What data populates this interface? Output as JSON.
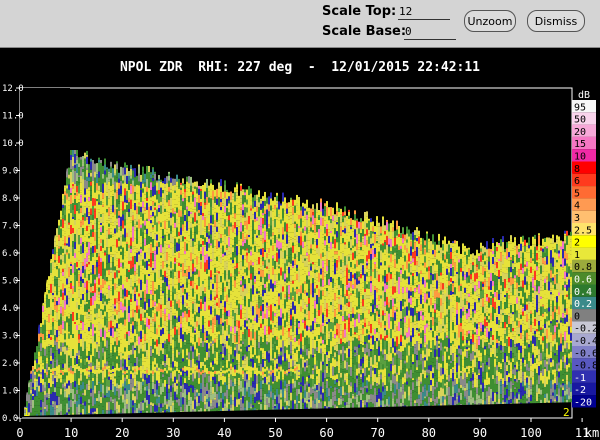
{
  "controls": {
    "scale_top_label": "Scale Top:",
    "scale_top_value": "12",
    "scale_base_label": "Scale Base:",
    "scale_base_value": "0",
    "unzoom_label": "Unzoom",
    "dismiss_label": "Dismiss"
  },
  "plot": {
    "title": "NPOL ZDR  RHI: 227 deg  -  12/01/2015 22:42:11",
    "x_axis_unit": "km",
    "corner_left_label": "1",
    "corner_right_label": "2",
    "y_tick_labels": [
      "0.0",
      "1.0",
      "2.0",
      "3.0",
      "4.0",
      "5.0",
      "6.0",
      "7.0",
      "8.0",
      "9.0",
      "10.0",
      "11.0",
      "12.0"
    ],
    "x_tick_labels": [
      "0",
      "10",
      "20",
      "30",
      "40",
      "50",
      "60",
      "70",
      "80",
      "90",
      "100",
      "11"
    ]
  },
  "colorbar": {
    "unit": "dB",
    "labels": [
      "95",
      "50",
      "20",
      "15",
      "10",
      "8",
      "6",
      "5",
      "4",
      "3",
      "2.5",
      "2",
      "1",
      "0.8",
      "0.6",
      "0.4",
      "0.2",
      "0",
      "-0.2",
      "-0.4",
      "-0.6",
      "-0.8",
      "-1",
      "-2",
      "-20"
    ],
    "colors": [
      "#f7f7f7",
      "#f9d4ec",
      "#f7a8d8",
      "#f577c4",
      "#f02aa6",
      "#ff0000",
      "#ff3a1e",
      "#ff6b33",
      "#ff9a52",
      "#ffbf70",
      "#ffe36b",
      "#ffff00",
      "#e8e83a",
      "#9caa3c",
      "#4c8a2a",
      "#2e7a2e",
      "#3a8a8a",
      "#808080",
      "#c8c8d4",
      "#a8a8d0",
      "#8080c8",
      "#5858c0",
      "#3030b0",
      "#1818a0",
      "#000090"
    ]
  }
}
